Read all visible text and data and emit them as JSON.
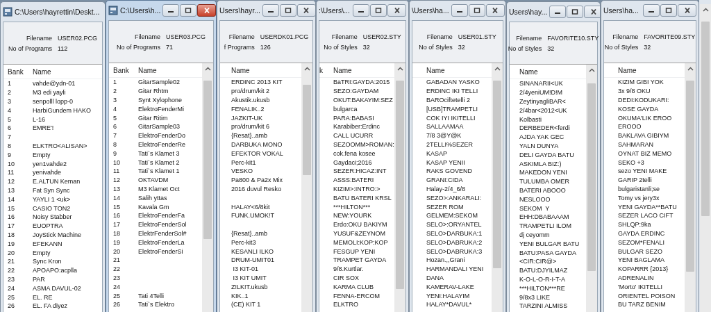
{
  "windows": [
    {
      "title": "C:\\Users\\hayrettin\\Deskt...",
      "icon": true,
      "buttons": false,
      "active": false,
      "filename_label": "Filename",
      "filename": "USER02.PCG",
      "count_label": "No of Programs",
      "count": "112",
      "columns": [
        "Bank",
        "Name"
      ],
      "rows": [
        {
          "bank": "1",
          "name": "vahde@ydn-01"
        },
        {
          "bank": "2",
          "name": "M3 edi yayli"
        },
        {
          "bank": "3",
          "name": "senpolll lopp-0"
        },
        {
          "bank": "4",
          "name": "HarbiGundem HAKO"
        },
        {
          "bank": "5",
          "name": "L-16"
        },
        {
          "bank": "6",
          "name": "EMRE'!"
        },
        {
          "bank": "7"
        },
        {
          "bank": "8",
          "name": "ELKTRO<ALISAN>"
        },
        {
          "bank": "9",
          "name": "Empty"
        },
        {
          "bank": "10",
          "name": "yen1vahde2"
        },
        {
          "bank": "11",
          "name": "yenivahde"
        },
        {
          "bank": "12",
          "name": "E.ALTUN Keman"
        },
        {
          "bank": "13",
          "name": "Fat Syn Sync"
        },
        {
          "bank": "14",
          "name": "YAYLI 1 <uk>"
        },
        {
          "bank": "15",
          "name": "CASIO TON2"
        },
        {
          "bank": "16",
          "name": "Noisy Stabber"
        },
        {
          "bank": "17",
          "name": "EUOPTRA"
        },
        {
          "bank": "18",
          "name": "JoyStick Machine"
        },
        {
          "bank": "19",
          "name": "EFEKANN"
        },
        {
          "bank": "20",
          "name": "Empty"
        },
        {
          "bank": "21",
          "name": "Sync Kron"
        },
        {
          "bank": "22",
          "name": "APOAPO:acplla"
        },
        {
          "bank": "23",
          "name": "PAR"
        },
        {
          "bank": "24",
          "name": "ASMA DAVUL-02"
        },
        {
          "bank": "25",
          "name": "EL. RE"
        },
        {
          "bank": "26",
          "name": "EL. FA diyez"
        }
      ]
    },
    {
      "title": "C:\\Users\\h...",
      "icon": true,
      "buttons": true,
      "active": true,
      "filename_label": "Filename",
      "filename": "USER03.PCG",
      "count_label": "No of Programs",
      "count": "71",
      "columns": [
        "Bank",
        "Name"
      ],
      "rows": [
        {
          "bank": "1",
          "name": "GitarSample02"
        },
        {
          "bank": "2",
          "name": "Gitar Rhtm"
        },
        {
          "bank": "3",
          "name": "Synt Xylophone"
        },
        {
          "bank": "4",
          "name": "ElektroFenderMi"
        },
        {
          "bank": "5",
          "name": "Gitar Ritim"
        },
        {
          "bank": "6",
          "name": "GitarSample03"
        },
        {
          "bank": "7",
          "name": "ElektroFenderDo"
        },
        {
          "bank": "8",
          "name": "ElektroFenderRe"
        },
        {
          "bank": "9",
          "name": "Tati`s Klamet 3"
        },
        {
          "bank": "10",
          "name": "Tati`s Klamet 2"
        },
        {
          "bank": "11",
          "name": "Tati`s Klamet 1"
        },
        {
          "bank": "12",
          "name": "OKTAVDM"
        },
        {
          "bank": "13",
          "name": "M3 Klamet Oct"
        },
        {
          "bank": "14",
          "name": "Salih yttas"
        },
        {
          "bank": "15",
          "name": "Kavala Gm"
        },
        {
          "bank": "16",
          "name": "ElektroFenderFa"
        },
        {
          "bank": "17",
          "name": "ElektroFenderSol"
        },
        {
          "bank": "18",
          "name": "ElektrFenderSol#"
        },
        {
          "bank": "19",
          "name": "ElektroFenderLa"
        },
        {
          "bank": "20",
          "name": "ElektroFenderSi"
        },
        {
          "bank": "21"
        },
        {
          "bank": "22"
        },
        {
          "bank": "23"
        },
        {
          "bank": "24"
        },
        {
          "bank": "25",
          "name": "Tati 4Telli"
        },
        {
          "bank": "26",
          "name": "Tati`s Elektro"
        }
      ]
    },
    {
      "title": "Users\\hayr...",
      "icon": false,
      "buttons": true,
      "active": false,
      "filename_label": "Filename",
      "filename": "USERDK01.PCG",
      "count_label": "f Programs",
      "count": "126",
      "columns": [
        "Name"
      ],
      "rows": [
        {
          "name": "ERDINC 2013 KIT"
        },
        {
          "name": "pro/drum/kit 2"
        },
        {
          "name": "Akustik.ukusb"
        },
        {
          "name": "FENALIK..2"
        },
        {
          "name": "JAZKIT-UK"
        },
        {
          "name": "pro/drum/kit 6"
        },
        {
          "name": "{Resat}..amb"
        },
        {
          "name": "DARBUKA MONO"
        },
        {
          "name": "EFEKTOR VOKAL"
        },
        {
          "name": "Perc-kit1"
        },
        {
          "name": "VESKO"
        },
        {
          "name": "Pa800 & Pa2x Mix"
        },
        {
          "name": "2016 duvul Resko"
        },
        {},
        {
          "name": "HALAY<6/8kit"
        },
        {
          "name": "FUNK.UMOK!T"
        },
        {},
        {
          "name": "{Resat}..amb"
        },
        {
          "name": "Perc-kit3"
        },
        {
          "name": "KESANLI ILKO"
        },
        {
          "name": "DRUM-UMIT01"
        },
        {
          "name": " I3 KIT-01"
        },
        {
          "name": " I3 KIT UMIT"
        },
        {
          "name": "Z!LK!T.ukusb"
        },
        {
          "name": "KIK..1"
        },
        {
          "name": "(CE) KIT 1"
        }
      ]
    },
    {
      "title": ":\\Users\\...",
      "icon": false,
      "buttons": true,
      "active": false,
      "filename_label": "Filename",
      "filename": "USER02.STY",
      "count_label": "No of Styles",
      "count": "32",
      "columns": [
        "k",
        "Name"
      ],
      "rows": [
        {
          "name": "BaTRI:GAYDA:2015"
        },
        {
          "name": "SEZO:GAYDAM"
        },
        {
          "name": "OKUT:BAKAYIM:SEZ"
        },
        {
          "name": "bulgarca"
        },
        {
          "name": "PARA:BABASI"
        },
        {
          "name": "Karabiber:Erdinc"
        },
        {
          "name": "CALL UCURR"
        },
        {
          "name": "SEZOOMM>ROMAN:"
        },
        {
          "name": "cok.fena kosee"
        },
        {
          "name": "Gaydaci;2016"
        },
        {
          "name": "SEZER:HICAZ:INT"
        },
        {
          "name": "ASSS:BATERI"
        },
        {
          "name": "KIZIM>:INTRO:>"
        },
        {
          "name": "BATU BATERI KRSL"
        },
        {
          "name": "***HILTON***"
        },
        {
          "name": "NEW:YOURK"
        },
        {
          "name": "Erdo:OKU BAKIYM"
        },
        {
          "name": "YUSUF&ZEYNOM"
        },
        {
          "name": "MEMOLI:KOP:KOP"
        },
        {
          "name": "FESGUP YENI"
        },
        {
          "name": "TRAMPET GAYDA"
        },
        {
          "name": "9/8.Kurtlar."
        },
        {
          "name": "CIR SOX"
        },
        {
          "name": "KARMA CLUB"
        },
        {
          "name": "FENNA-ERCOM"
        },
        {
          "name": "ELKTRO"
        }
      ]
    },
    {
      "title": "\\Users\\ha...",
      "icon": false,
      "buttons": true,
      "active": false,
      "filename_label": "Filename",
      "filename": "USER01.STY",
      "count_label": "No of Styles",
      "count": "32",
      "columns": [
        "Name"
      ],
      "rows": [
        {
          "name": "GABADAN YASKO"
        },
        {
          "name": "ERDINC IKI TELLI"
        },
        {
          "name": "BAROciftetelli 2"
        },
        {
          "name": "[USB]TRAMPETLI"
        },
        {
          "name": "COK IYI IKITELLI"
        },
        {
          "name": "SALLAAMAA"
        },
        {
          "name": "7/8 3@Y@K"
        },
        {
          "name": "2TELLI%SEZER"
        },
        {
          "name": "KASAP"
        },
        {
          "name": "KASAP YENII"
        },
        {
          "name": "RAKS GOVEND"
        },
        {
          "name": "GRANI:CIDA"
        },
        {
          "name": "Halay-2/4_6/8"
        },
        {
          "name": "SEZO>:ANKARALI:"
        },
        {
          "name": "SEZER ROM"
        },
        {
          "name": "GELMEM:SEKOM"
        },
        {
          "name": "SELO>:ORYANTEL"
        },
        {
          "name": "SELO>DARBUKA:1"
        },
        {
          "name": "SELO>DABRUKA:2"
        },
        {
          "name": "SELO>DABRUKA:3"
        },
        {
          "name": "Hozan.,,Grani"
        },
        {
          "name": "HARMANDALI YENI"
        },
        {
          "name": "DANA"
        },
        {
          "name": "KAMERAV-LAKE"
        },
        {
          "name": "YENI:HALAYIM"
        },
        {
          "name": "HALAY*DAVUL*"
        }
      ]
    },
    {
      "title": "Users\\hay...",
      "icon": false,
      "buttons": true,
      "active": false,
      "filename_label": "Filename",
      "filename": "FAVORITE10.STY",
      "count_label": "No of Styles",
      "count": "32",
      "columns": [
        "Name"
      ],
      "rows": [
        {
          "name": "SINANARII<UK"
        },
        {
          "name": "2/4yeniUM!D!M"
        },
        {
          "name": "ZeytinyagliBAR<"
        },
        {
          "name": "2/4bar<2012<UK"
        },
        {
          "name": "Kolbasti"
        },
        {
          "name": "DERBEDER<ferdi"
        },
        {
          "name": "AJDA YAK GEC"
        },
        {
          "name": "YALN DUNYA"
        },
        {
          "name": "DELI GAYDA BATU"
        },
        {
          "name": "ASKIMLA BIZ:)"
        },
        {
          "name": "MAKEDON YENI"
        },
        {
          "name": "TULUMBA OMER"
        },
        {
          "name": "BATERI ABOOO"
        },
        {
          "name": "NESLOOO"
        },
        {
          "name": "SEKOM  Y"
        },
        {
          "name": "EHH:DBABAAAM"
        },
        {
          "name": "TRAMPETLI ILOM"
        },
        {
          "name": "dj ceyomm"
        },
        {
          "name": "YENI BULGAR BATU"
        },
        {
          "name": "BATU:PASA GAYDA"
        },
        {
          "name": "<CIR:CIR@>"
        },
        {
          "name": "BATU:DJYILMAZ"
        },
        {
          "name": "K-O-L-O-R-I-T-A"
        },
        {
          "name": "***HILTON***RE"
        },
        {
          "name": "9/8x3 LIKE"
        },
        {
          "name": "TARZINI ALMISS"
        }
      ]
    },
    {
      "title": "Users\\ha...",
      "icon": false,
      "buttons": true,
      "active": false,
      "filename_label": "Filename",
      "filename": "FAVORITE09.STY",
      "count_label": "No of Styles",
      "count": "32",
      "columns": [
        "Name"
      ],
      "rows": [
        {
          "name": "KIZIM GIBI YOK"
        },
        {
          "name": "3x 9/8 OKU"
        },
        {
          "name": "DEDI:KODUKARI:"
        },
        {
          "name": "KOSE GAYDA"
        },
        {
          "name": "OKUMA'LIK EROO"
        },
        {
          "name": "EROOO"
        },
        {
          "name": "BAKLAVA GIBIYM"
        },
        {
          "name": "SAHMARAN"
        },
        {
          "name": "OYNAT BIZ MEMO"
        },
        {
          "name": "SEKO +3"
        },
        {
          "name": "sezo YENI MAKE"
        },
        {
          "name": "GARIP 2telli"
        },
        {
          "name": "bulgaristanli;se"
        },
        {
          "name": "Tomy vs jery3x"
        },
        {
          "name": "YENI GAYDA**BATU"
        },
        {
          "name": "SEZER LACO CIFT"
        },
        {
          "name": "SHLQP:9ka"
        },
        {
          "name": "GAYDA ERDINC"
        },
        {
          "name": "SEZOM*FENALI"
        },
        {
          "name": "BULGAR SEZO"
        },
        {
          "name": "YENI BAGLAMA"
        },
        {
          "name": "KOPARRR {2013}"
        },
        {
          "name": "ADRENALIN"
        },
        {
          "name": "'Morto' IKITELLI"
        },
        {
          "name": "ORIENTEL POISON"
        },
        {
          "name": "BU TARZ BENIM"
        }
      ]
    }
  ]
}
